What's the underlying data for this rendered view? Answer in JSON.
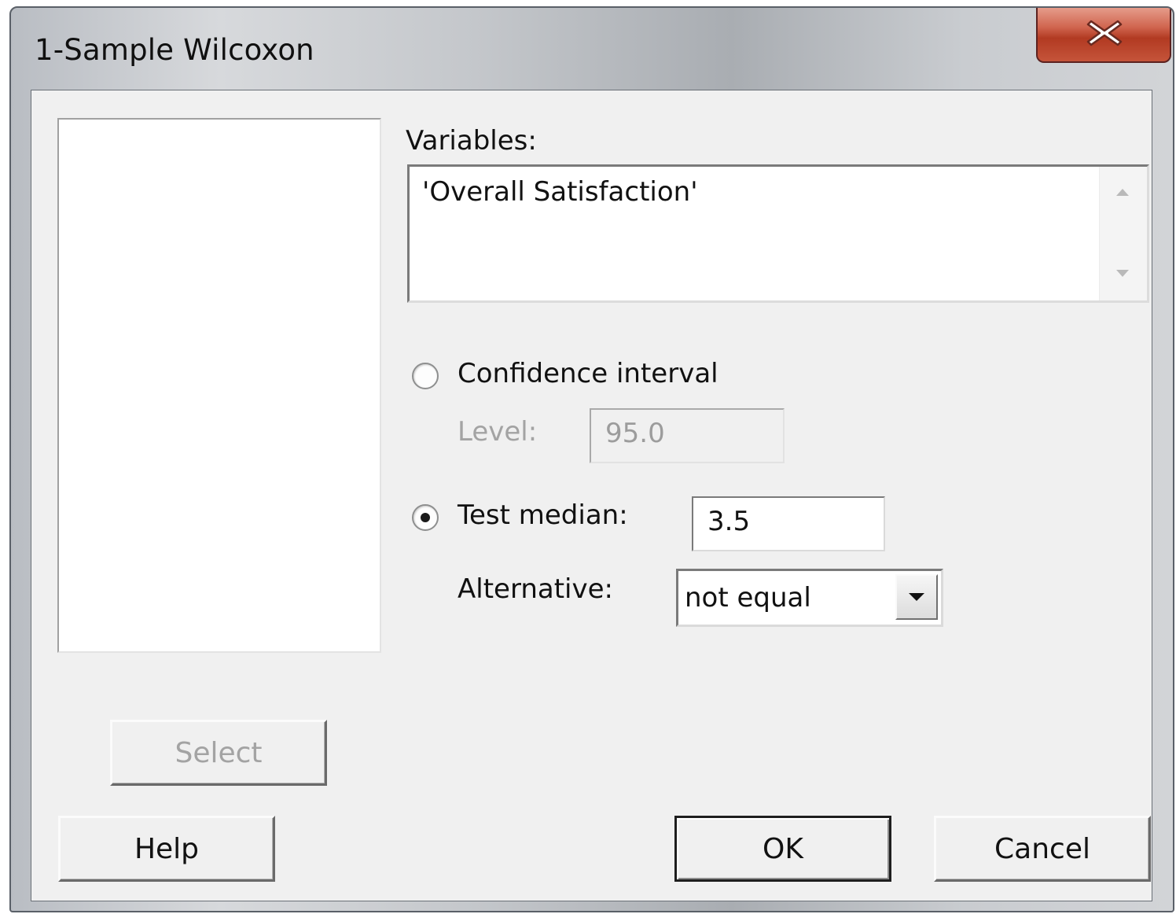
{
  "window": {
    "title": "1-Sample Wilcoxon",
    "close_glyph": "X"
  },
  "variables": {
    "label": "Variables:",
    "value": "'Overall Satisfaction'"
  },
  "confidence_interval": {
    "label": "Confidence interval",
    "selected": false,
    "level_label": "Level:",
    "level_value": "95.0",
    "enabled": false
  },
  "test_median": {
    "label": "Test median:",
    "selected": true,
    "value": "3.5"
  },
  "alternative": {
    "label": "Alternative:",
    "selected_value": "not equal"
  },
  "buttons": {
    "select": "Select",
    "help": "Help",
    "ok": "OK",
    "cancel": "Cancel"
  },
  "icons": {
    "close": "close-icon",
    "scroll_up": "scroll-up-arrow-icon",
    "scroll_down": "scroll-down-arrow-icon",
    "dropdown": "chevron-down-icon"
  },
  "colors": {
    "close_button": "#c5543a",
    "client_background": "#f0f0f0"
  }
}
